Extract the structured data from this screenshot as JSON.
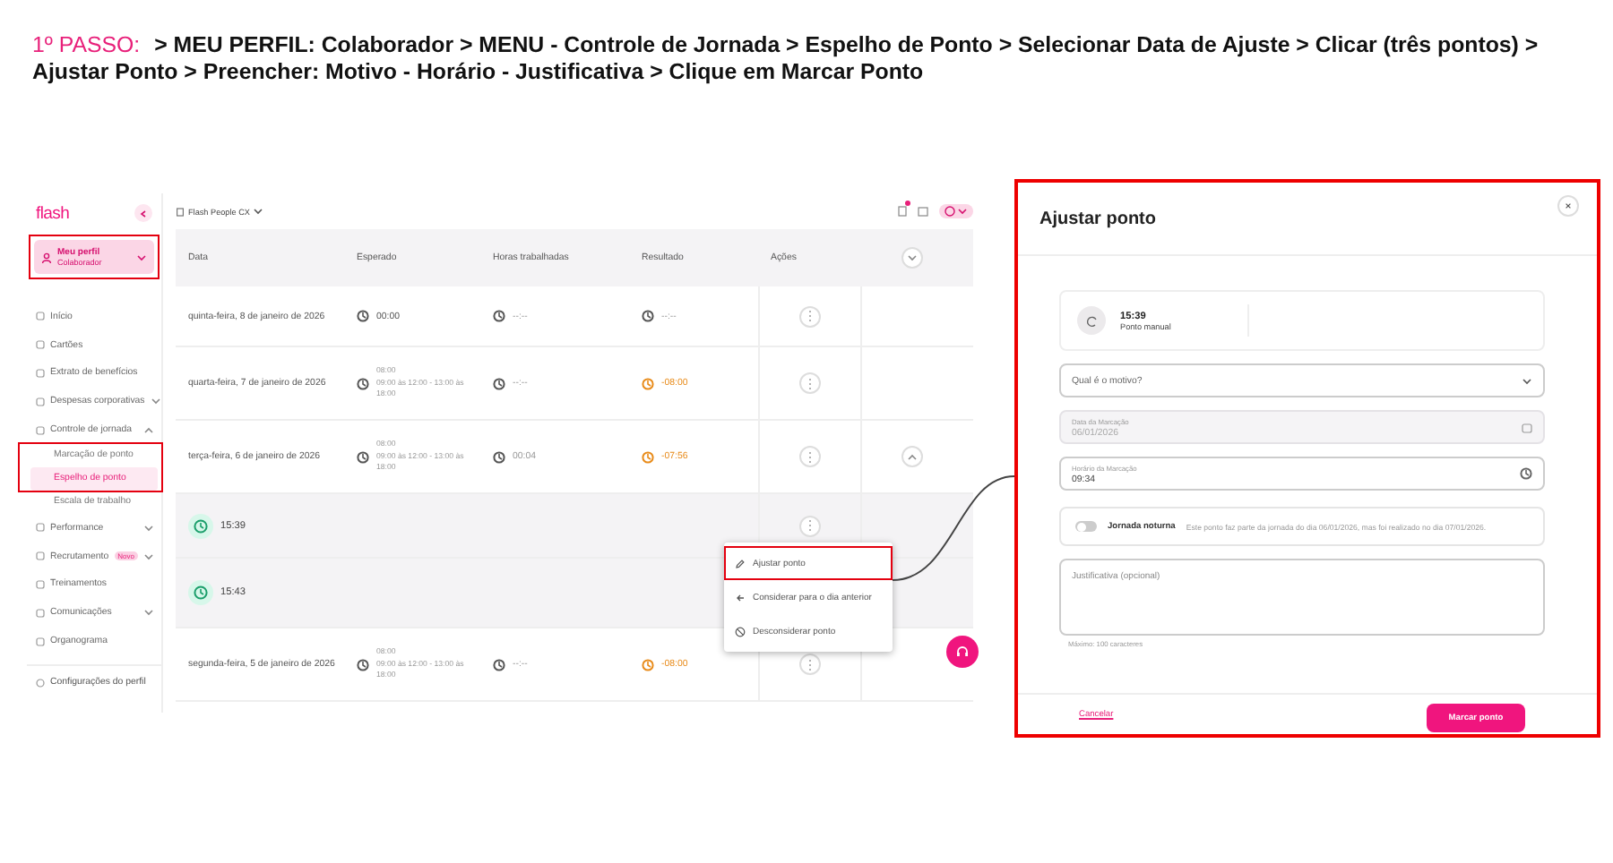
{
  "instruction": {
    "step_label": "1º PASSO:",
    "text": "> MEU PERFIL: Colaborador > MENU - Controle de Jornada > Espelho de Ponto > Selecionar Data de Ajuste > Clicar (três pontos) > Ajustar Ponto > Preencher: Motivo - Horário - Justificativa > Clique em Marcar Ponto"
  },
  "app": {
    "logo": "flash",
    "company": "Flash People CX",
    "profile": {
      "name": "Meu perfil",
      "role": "Colaborador",
      "highlighted": true
    },
    "sidebar": {
      "items": [
        {
          "label": "Início",
          "selected": false
        },
        {
          "label": "Cartões",
          "selected": false
        },
        {
          "label": "Extrato de benefícios",
          "selected": false
        },
        {
          "label": "Despesas corporativas",
          "selected": false,
          "expanded": false
        },
        {
          "label": "Controle de jornada",
          "selected": false,
          "expanded": true,
          "children": [
            {
              "label": "Marcação de ponto",
              "selected": false,
              "highlighted": true
            },
            {
              "label": "Espelho de ponto",
              "selected": true,
              "highlighted": true
            },
            {
              "label": "Escala de trabalho",
              "selected": false,
              "highlighted": false
            }
          ]
        },
        {
          "label": "Performance",
          "selected": false,
          "expanded": false
        },
        {
          "label": "Recrutamento",
          "selected": false,
          "expanded": false,
          "badge": "Novo"
        },
        {
          "label": "Treinamentos",
          "selected": false
        },
        {
          "label": "Comunicações",
          "selected": false,
          "expanded": false
        },
        {
          "label": "Organograma",
          "selected": false
        }
      ],
      "footer": "Configurações do perfil"
    },
    "table": {
      "columns": [
        "Data",
        "Esperado",
        "Horas trabalhadas",
        "Resultado",
        "Ações"
      ],
      "rows": [
        {
          "kind": "day",
          "date": "quinta-feira, 8 de janeiro de 2026",
          "expected": "00:00",
          "worked": "--:--",
          "result": "--:--",
          "result_negative": false
        },
        {
          "kind": "day",
          "date": "quarta-feira, 7 de janeiro de 2026",
          "expected": "08:00",
          "schedule": "09:00 às 12:00 - 13:00 às 18:00",
          "worked": "--:--",
          "result": "-08:00",
          "result_negative": true
        },
        {
          "kind": "day",
          "date": "terça-feira, 6 de janeiro de 2026",
          "expected": "08:00",
          "schedule": "09:00 às 12:00 - 13:00 às 18:00",
          "worked": "00:04",
          "result": "-07:56",
          "result_negative": true,
          "expanded": true
        },
        {
          "kind": "punch",
          "time": "15:39"
        },
        {
          "kind": "punch",
          "time": "15:43"
        },
        {
          "kind": "day",
          "date": "segunda-feira, 5 de janeiro de 2026",
          "expected": "08:00",
          "schedule": "09:00 às 12:00 - 13:00 às 18:00",
          "worked": "--:--",
          "result": "-08:00",
          "result_negative": true
        }
      ]
    },
    "menu": [
      {
        "label": "Ajustar ponto",
        "highlighted": true
      },
      {
        "label": "Considerar para o dia anterior",
        "highlighted": false
      },
      {
        "label": "Desconsiderar ponto",
        "highlighted": false
      }
    ]
  },
  "modal": {
    "title": "Ajustar ponto",
    "highlighted": true,
    "punch": {
      "time": "15:39",
      "type": "Ponto manual"
    },
    "reason": {
      "placeholder": "Qual é o motivo?"
    },
    "date_field": {
      "label": "Data da Marcação",
      "value": "06/01/2026",
      "disabled": true
    },
    "time_field": {
      "label": "Horário da Marcação",
      "value": "09:34",
      "disabled": false
    },
    "night_shift": {
      "label": "Jornada noturna",
      "on": false,
      "note": "Este ponto faz parte da jornada do dia 06/01/2026, mas foi realizado no dia 07/01/2026."
    },
    "justification": {
      "placeholder": "Justificativa (opcional)",
      "hint": "Máximo: 100 caracteres"
    },
    "buttons": {
      "cancel": "Cancelar",
      "submit": "Marcar ponto"
    }
  }
}
